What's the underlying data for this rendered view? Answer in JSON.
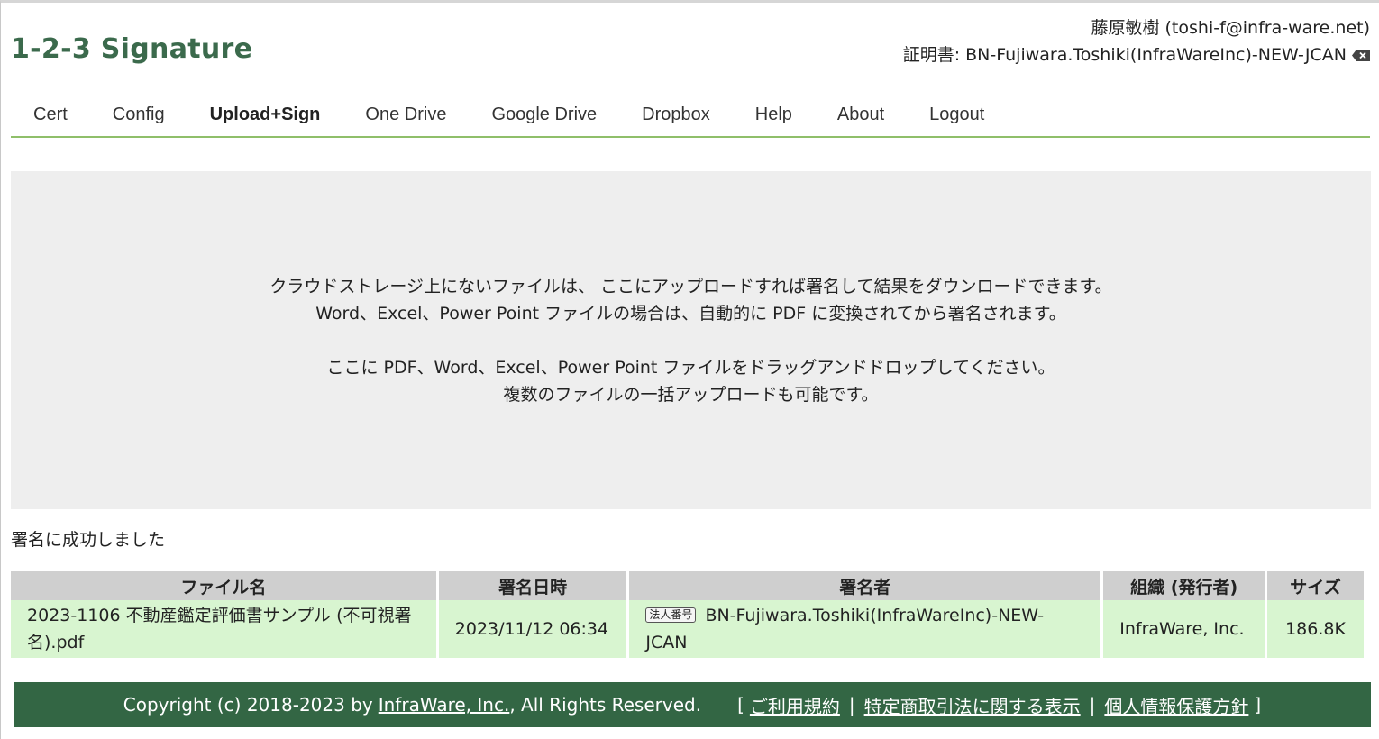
{
  "app": {
    "title": "1-2-3 Signature"
  },
  "user": {
    "name_email": "藤原敏樹 (toshi-f@infra-ware.net)",
    "cert_label": "証明書: BN-Fujiwara.Toshiki(InfraWareInc)-NEW-JCAN"
  },
  "nav": {
    "items": [
      {
        "label": "Cert"
      },
      {
        "label": "Config"
      },
      {
        "label": "Upload+Sign"
      },
      {
        "label": "One Drive"
      },
      {
        "label": "Google Drive"
      },
      {
        "label": "Dropbox"
      },
      {
        "label": "Help"
      },
      {
        "label": "About"
      },
      {
        "label": "Logout"
      }
    ],
    "active": "Upload+Sign"
  },
  "dropzone": {
    "line1": "クラウドストレージ上にないファイルは、 ここにアップロードすれば署名して結果をダウンロードできます。",
    "line2": "Word、Excel、Power Point ファイルの場合は、自動的に PDF に変換されてから署名されます。",
    "line3": "ここに PDF、Word、Excel、Power Point ファイルをドラッグアンドドロップしてください。",
    "line4": "複数のファイルの一括アップロードも可能です。"
  },
  "status": {
    "message": "署名に成功しました"
  },
  "results": {
    "headers": {
      "filename": "ファイル名",
      "signed_at": "署名日時",
      "signer": "署名者",
      "org": "組織 (発行者)",
      "size": "サイズ"
    },
    "rows": [
      {
        "filename": "2023-1106 不動産鑑定評価書サンプル (不可視署名).pdf",
        "signed_at": "2023/11/12 06:34",
        "badge": "法人番号",
        "signer": "BN-Fujiwara.Toshiki(InfraWareInc)-NEW-JCAN",
        "org": "InfraWare, Inc.",
        "size": "186.8K"
      }
    ]
  },
  "footer": {
    "copyright_prefix": "Copyright (c) 2018-2023 by",
    "company_link": "InfraWare, Inc.",
    "copyright_suffix": ", All Rights Reserved.",
    "bracket_open": "[",
    "terms_link": "ご利用規約",
    "divider1": "|",
    "commerce_link": "特定商取引法に関する表示",
    "divider2": "|",
    "privacy_link": "個人情報保護方針",
    "bracket_close": "]"
  },
  "colors": {
    "brand": "#3b6a4c",
    "nav_underline": "#8fbf6a",
    "footer_bg": "#336644",
    "row_bg": "#d8f5d0",
    "header_bg": "#cfcfcf",
    "dropzone_bg": "#eeeeee"
  }
}
